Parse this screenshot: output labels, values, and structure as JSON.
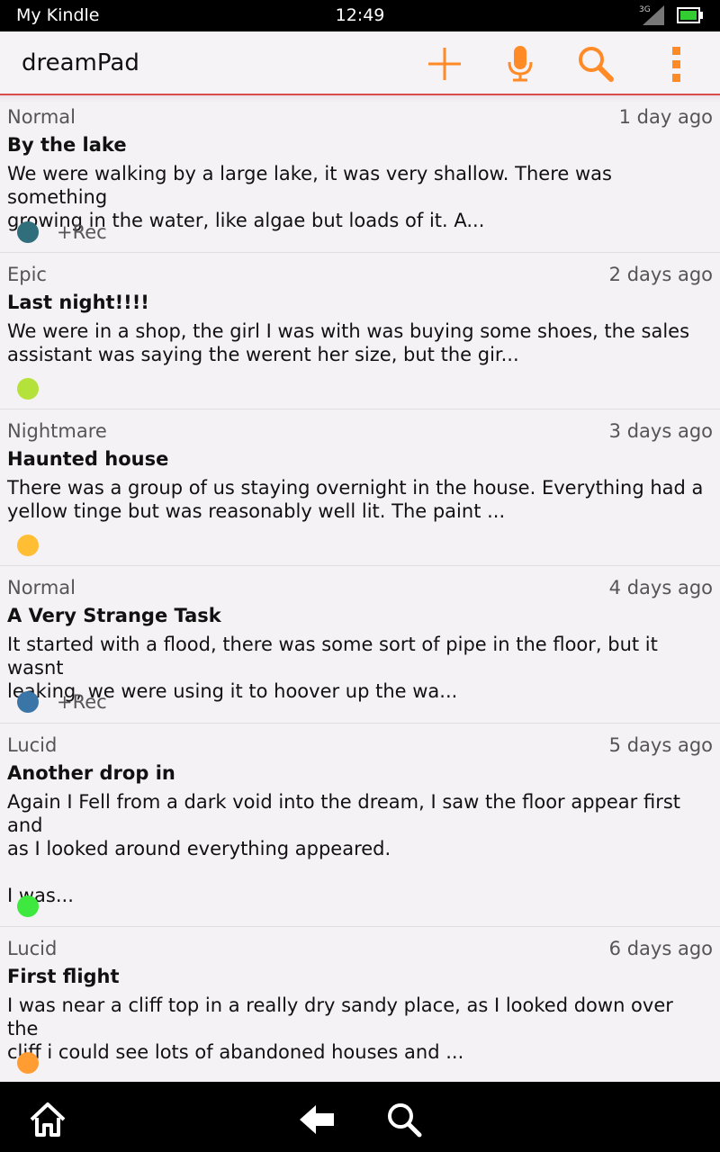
{
  "status_bar": {
    "carrier": "My Kindle",
    "time": "12:49",
    "network": "3G",
    "battery_color": "#33cc33"
  },
  "action_bar": {
    "title": "dreamPad",
    "accent_color": "#ff8a26",
    "divider_color": "#d94d4d",
    "actions": [
      {
        "icon": "plus-icon"
      },
      {
        "icon": "microphone-icon"
      },
      {
        "icon": "search-icon"
      },
      {
        "icon": "overflow-menu-icon"
      }
    ]
  },
  "dreams": [
    {
      "category": "Normal",
      "date": "1 day ago",
      "title": "By the lake",
      "excerpt": "We were walking by a large lake, it was very shallow. There was something\ngrowing in the water, like algae but loads of it. A...",
      "color": "#2f6e7a",
      "rec": "+Rec"
    },
    {
      "category": "Epic",
      "date": "2 days ago",
      "title": "Last night!!!!",
      "excerpt": "We were in a shop, the girl I was with was buying some shoes, the sales\nassistant was saying the werent her size, but the gir...",
      "color": "#b5e23a",
      "rec": ""
    },
    {
      "category": "Nightmare",
      "date": "3 days ago",
      "title": "Haunted house",
      "excerpt": "There was a group of us staying overnight in the house. Everything had a\nyellow tinge but was reasonably well lit. The paint ...",
      "color": "#ffbe33",
      "rec": ""
    },
    {
      "category": "Normal",
      "date": "4 days ago",
      "title": "A Very Strange Task",
      "excerpt": "It started with a flood, there was some sort of pipe in the floor, but it wasnt\nleaking, we were using it to hoover up the wa...",
      "color": "#3a75a8",
      "rec": "+Rec"
    },
    {
      "category": "Lucid",
      "date": "5 days ago",
      "title": "Another drop in",
      "excerpt": "Again I Fell from a dark void into the dream, I saw the floor appear first and\nas I looked around everything appeared.\n\nI was...",
      "color": "#3ee83e",
      "rec": ""
    },
    {
      "category": "Lucid",
      "date": "6 days ago",
      "title": "First flight",
      "excerpt": "I was near a cliff top in a really dry sandy place, as I looked down over the\ncliff i could see lots of abandoned houses and ...",
      "color": "#ff9d33",
      "rec": ""
    }
  ],
  "nav_bar": {
    "buttons": [
      {
        "icon": "home-icon"
      },
      {
        "icon": "back-arrow-icon"
      },
      {
        "icon": "search-icon"
      }
    ]
  }
}
